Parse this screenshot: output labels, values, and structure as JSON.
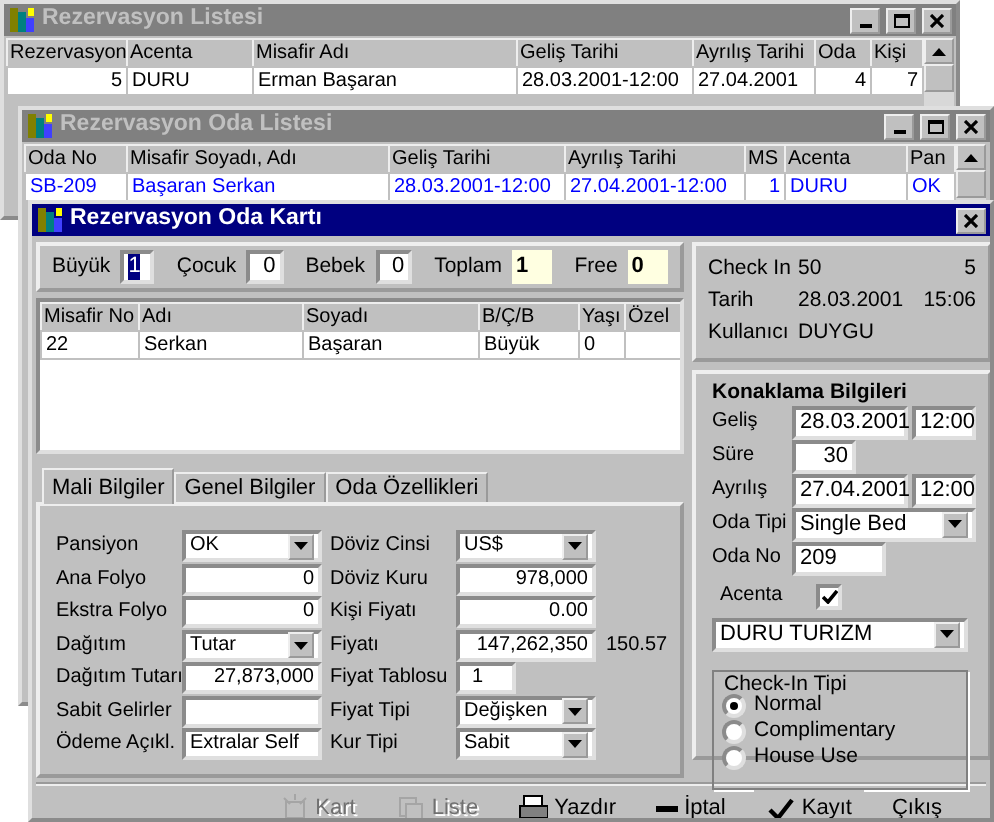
{
  "reservation_list": {
    "title": "Rezervasyon Listesi",
    "columns": [
      "Rezervasyon",
      "Acenta",
      "Misafir Adı",
      "Geliş Tarihi",
      "Ayrılış Tarihi",
      "Oda",
      "Kişi"
    ],
    "rows": [
      {
        "selected": false,
        "cells": [
          "5",
          "DURU",
          "Erman Başaran",
          "28.03.2001-12:00",
          "27.04.2001",
          "4",
          "7"
        ]
      }
    ]
  },
  "room_list": {
    "title": "Rezervasyon Oda Listesi",
    "columns": [
      "Oda No",
      "Misafir Soyadı, Adı",
      "Geliş Tarihi",
      "Ayrılış Tarihi",
      "MS",
      "Acenta",
      "Pan"
    ],
    "rows": [
      {
        "selected": true,
        "cells": [
          "SB-209",
          "Başaran Serkan",
          "28.03.2001-12:00",
          "27.04.2001-12:00",
          "1",
          "DURU",
          "OK"
        ]
      }
    ]
  },
  "room_card": {
    "title": "Rezervasyon Oda Kartı",
    "counts": [
      {
        "label": "Büyük",
        "value": "1",
        "kind": "input",
        "highlighted": true
      },
      {
        "label": "Çocuk",
        "value": "0",
        "kind": "input",
        "highlighted": false
      },
      {
        "label": "Bebek",
        "value": "0",
        "kind": "input",
        "highlighted": false
      },
      {
        "label": "Toplam",
        "value": "1",
        "kind": "readonly"
      },
      {
        "label": "Free",
        "value": "0",
        "kind": "readonly"
      }
    ],
    "guests": {
      "columns": [
        "Misafir No",
        "Adı",
        "Soyadı",
        "B/Ç/B",
        "Yaşı",
        "Özel"
      ],
      "rows": [
        [
          "22",
          "Serkan",
          "Başaran",
          "Büyük",
          "0"
        ]
      ]
    },
    "info": [
      {
        "label": "Check In",
        "value": "50",
        "extra": "5"
      },
      {
        "label": "Tarih",
        "value": "28.03.2001",
        "extra": "15:06"
      },
      {
        "label": "Kullanıcı",
        "value": "DUYGU"
      }
    ],
    "tabs": [
      {
        "label": "Mali Bilgiler",
        "selected": true
      },
      {
        "label": "Genel Bilgiler",
        "selected": false
      },
      {
        "label": "Oda Özellikleri",
        "selected": false
      }
    ],
    "finance_left": [
      {
        "label": "Pansiyon",
        "value": "OK",
        "kind": "select"
      },
      {
        "label": "Ana Folyo",
        "value": "0",
        "kind": "number"
      },
      {
        "label": "Ekstra Folyo",
        "value": "0",
        "kind": "number"
      },
      {
        "label": "Dağıtım",
        "value": "Tutar",
        "kind": "select"
      },
      {
        "label": "Dağıtım Tutarı",
        "value": "27,873,000",
        "kind": "number"
      },
      {
        "label": "Sabit Gelirler",
        "kind": "text"
      },
      {
        "label": "Ödeme Açıkl.",
        "value": "Extralar Self",
        "kind": "text"
      }
    ],
    "finance_right": [
      {
        "label": "Döviz Cinsi",
        "value": "US$",
        "kind": "select"
      },
      {
        "label": "Döviz Kuru",
        "value": "978,000",
        "kind": "number"
      },
      {
        "label": "Kişi Fiyatı",
        "value": "0.00",
        "kind": "number"
      },
      {
        "label": "Fiyatı",
        "value": "147,262,350",
        "kind": "number",
        "extra": "150.57"
      },
      {
        "label": "Fiyat Tablosu",
        "value": "1",
        "kind": "short"
      },
      {
        "label": "Fiyat Tipi",
        "value": "Değişken",
        "kind": "select"
      },
      {
        "label": "Kur Tipi",
        "value": "Sabit",
        "kind": "select"
      }
    ],
    "accommodation": {
      "title": "Konaklama Bilgileri",
      "arrival": {
        "label": "Geliş",
        "date": "28.03.2001",
        "time": "12:00"
      },
      "duration": {
        "label": "Süre",
        "value": "30"
      },
      "departure": {
        "label": "Ayrılış",
        "date": "27.04.2001",
        "time": "12:00"
      },
      "room_type": {
        "label": "Oda Tipi",
        "value": "Single Bed"
      },
      "room_no": {
        "label": "Oda No",
        "value": "209"
      },
      "agency": {
        "label": "Acenta",
        "checked": true,
        "value": "DURU TURIZM"
      },
      "checkin_type": {
        "title": "Check-In Tipi",
        "options": [
          {
            "label": "Normal",
            "selected": true
          },
          {
            "label": "Complimentary",
            "selected": false
          },
          {
            "label": "House Use",
            "selected": false
          }
        ]
      }
    },
    "toolbar": [
      {
        "label": "Kart",
        "kind": "card",
        "disabled": true
      },
      {
        "label": "Liste",
        "kind": "list",
        "disabled": true
      },
      {
        "label": "Yazdır",
        "kind": "print",
        "disabled": false
      },
      {
        "label": "İptal",
        "kind": "cancel",
        "disabled": false
      },
      {
        "label": "Kayıt",
        "kind": "save",
        "disabled": false
      },
      {
        "label": "Çıkış",
        "kind": "exit",
        "disabled": false
      }
    ]
  }
}
